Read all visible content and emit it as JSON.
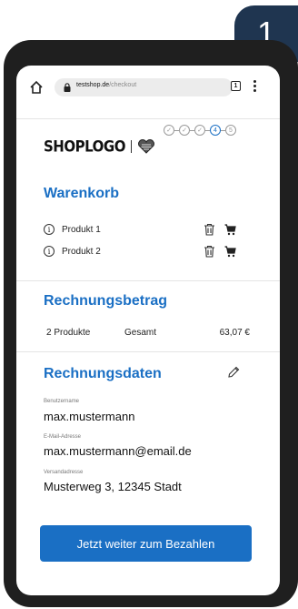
{
  "step_badge": "1",
  "browser": {
    "url_host": "testshop.de",
    "url_path": "/checkout",
    "tab_count": "1"
  },
  "checkout_steps": [
    "",
    "",
    "",
    "4",
    "5"
  ],
  "logo": {
    "text": "SHOPLOGO"
  },
  "cart": {
    "title": "Warenkorb",
    "items": [
      {
        "name": "Produkt 1"
      },
      {
        "name": "Produkt 2"
      }
    ]
  },
  "billing_amount": {
    "title": "Rechnungsbetrag",
    "product_count": "2 Produkte",
    "total_label": "Gesamt",
    "total_value": "63,07 €"
  },
  "billing_data": {
    "title": "Rechnungsdaten",
    "username_label": "Benutzername",
    "username_value": "max.mustermann",
    "email_label": "E-Mail-Adresse",
    "email_value": "max.mustermann@email.de",
    "address_label": "Versandadresse",
    "address_value": "Musterweg 3, 12345 Stadt"
  },
  "cta": {
    "label": "Jetzt weiter zum Bezahlen"
  },
  "colors": {
    "accent": "#1a6fc4",
    "frame": "#1f1f1f",
    "badge": "#1f3550"
  }
}
